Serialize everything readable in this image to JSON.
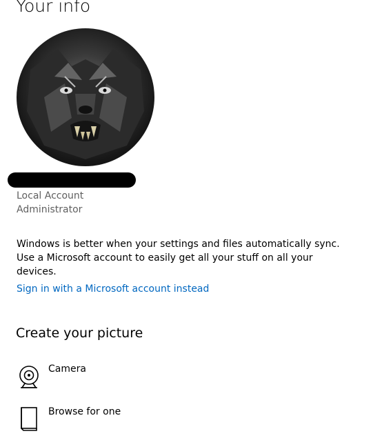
{
  "header": {
    "title": "Your info"
  },
  "account": {
    "avatar_icon": "profile-picture-wolf",
    "name_redacted": true,
    "type": "Local Account",
    "role": "Administrator"
  },
  "sync_message": {
    "line1": "Windows is better when your settings and files automatically sync.",
    "line2": "Use a Microsoft account to easily get all your stuff on all your",
    "line3": "devices."
  },
  "signin_link": {
    "label": "Sign in with a Microsoft account instead",
    "color": "#0067c0"
  },
  "create_picture": {
    "heading": "Create your picture",
    "options": [
      {
        "label": "Camera",
        "icon": "camera-icon"
      },
      {
        "label": "Browse for one",
        "icon": "document-icon"
      }
    ]
  }
}
